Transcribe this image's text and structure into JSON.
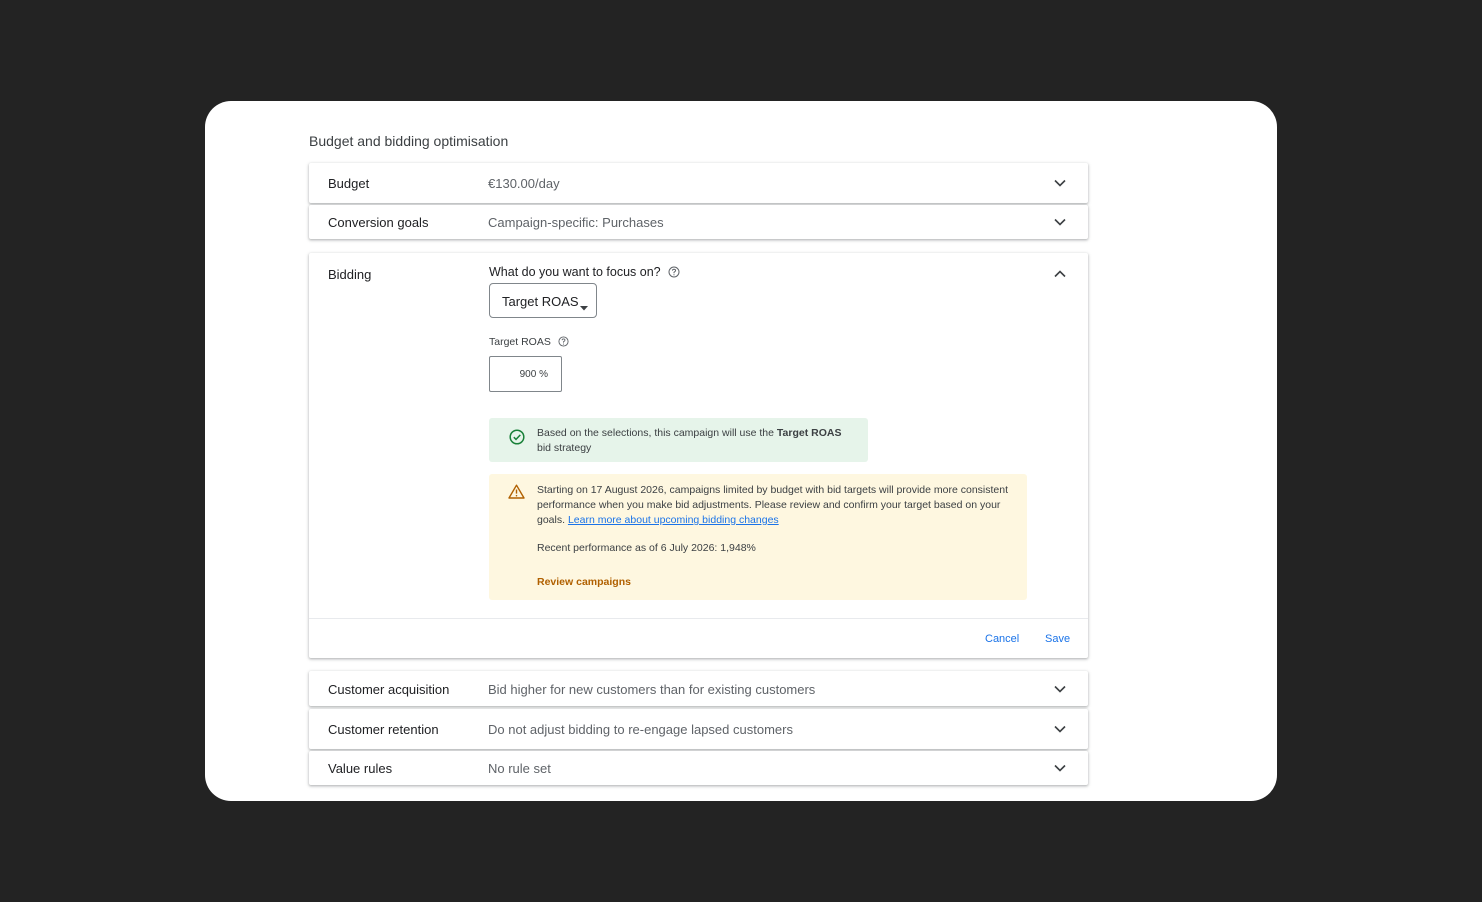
{
  "section_title": "Budget and bidding optimisation",
  "rows": {
    "budget": {
      "label": "Budget",
      "value": "€130.00/day"
    },
    "conversion_goals": {
      "label": "Conversion goals",
      "value": "Campaign-specific: Purchases"
    },
    "customer_acquisition": {
      "label": "Customer acquisition",
      "value": "Bid higher for new customers than for existing customers"
    },
    "customer_retention": {
      "label": "Customer retention",
      "value": "Do not adjust bidding to re-engage lapsed customers"
    },
    "value_rules": {
      "label": "Value rules",
      "value": "No rule set"
    }
  },
  "bidding": {
    "label": "Bidding",
    "focus_question": "What do you want to focus on?",
    "focus_selected": "Target ROAS",
    "target_roas_label": "Target ROAS",
    "target_roas_value": "900",
    "target_roas_unit": "%",
    "success_message_prefix": "Based on the selections, this campaign will use the ",
    "success_message_bold": "Target ROAS",
    "success_message_suffix": " bid strategy",
    "warning_message": "Starting on 17 August 2026, campaigns limited by budget with bid targets will provide more consistent performance when you make bid adjustments. Please review and confirm your target based on your goals. ",
    "warning_link": "Learn more about upcoming bidding changes",
    "recent_performance": "Recent performance as of 6 July 2026: 1,948%",
    "review_campaigns": "Review campaigns",
    "cancel_label": "Cancel",
    "save_label": "Save"
  },
  "colors": {
    "background": "#232323",
    "card": "#ffffff",
    "link": "#1a73e8",
    "success_bg": "#e6f4ea",
    "success_icon": "#188038",
    "warning_bg": "#fef7e0",
    "warning_icon": "#b06000",
    "review_link": "#b06000"
  },
  "icons": {
    "expand": "chevron-down-icon",
    "collapse": "chevron-up-icon",
    "help": "help-circle-icon",
    "dropdown": "caret-down-icon",
    "success": "check-circle-icon",
    "warning": "warning-triangle-icon"
  }
}
